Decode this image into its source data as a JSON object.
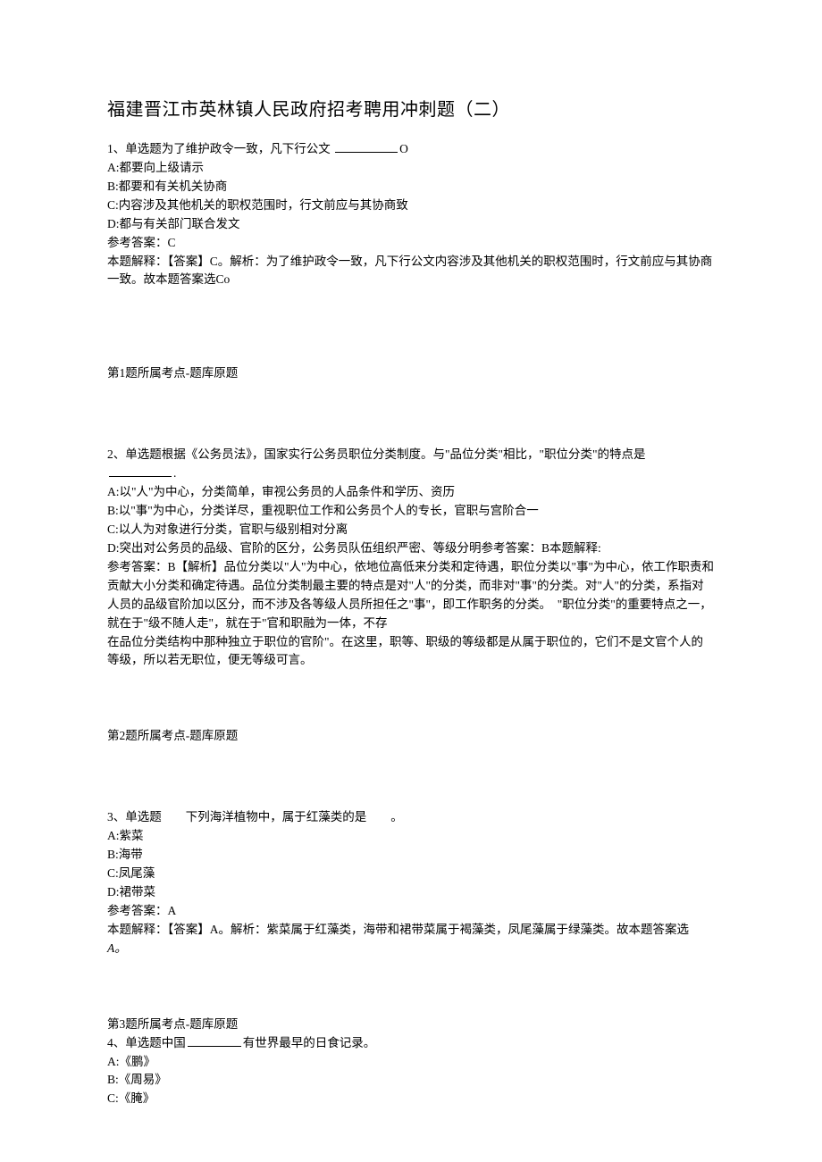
{
  "title": "福建晋江市英林镇人民政府招考聘用冲刺题（二）",
  "q1": {
    "stem_a": "1、单选题为了维护政令一致，凡下行公文 ",
    "stem_b": "O",
    "A": "A:都要向上级请示",
    "B": "B:都要和有关机关协商",
    "C": "C:内容涉及其他机关的职权范围时，行文前应与其协商致",
    "D": "D:都与有关部门联合发文",
    "ans_label": "参考答案：C",
    "expl": "本题解释：【答案】C。解析：为了维护政令一致，凡下行公文内容涉及其他机关的职权范围时，行文前应与其协商一致。故本题答案选Co",
    "meta": "第1题所属考点-题库原题"
  },
  "q2": {
    "stem": "2、单选题根据《公务员法》，国家实行公务员职位分类制度。与\"品位分类\"相比，\"职位分类\"的特点是",
    "A": "A:以\"人\"为中心，分类简单，审视公务员的人品条件和学历、资历",
    "B": "B:以\"事\"为中心，分类详尽，重视职位工作和公务员个人的专长，官职与宫阶合一",
    "C": "C:以人为对象进行分类，官职与级别相对分离",
    "D": "D:突出对公务员的品级、官阶的区分，公务员队伍组织严密、等级分明参考答案：B本题解释:",
    "expl1": "参考答案：B【解析】品位分类以\"人\"为中心，依地位高低来分类和定待遇，职位分类以\"事\"为中心，依工作职责和贡献大小分类和确定待遇。品位分类制最主要的特点是对\"人\"的分类，而非对\"事\"的分类。对\"人\"的分类，系指对人员的品级官阶加以区分，而不涉及各等级人员所担任之\"事\"，即工作职务的分类。　\"职位分类\"的重要特点之一，就在于\"级不随人走\"，就在于\"官和职融为一体，不存",
    "expl2": "在品位分类结构中那种独立于职位的官阶\"。在这里，职等、职级的等级都是从属于职位的，它们不是文官个人的等级，所以若无职位，便无等级可言。",
    "meta": "第2题所属考点-题库原题"
  },
  "q3": {
    "stem": "3、单选题　　下列海洋植物中，属于红藻类的是　　。",
    "A": "A:紫菜",
    "B": "B:海带",
    "C": "C:凤尾藻",
    "D": "D:裙带菜",
    "ans_label": "参考答案：A",
    "expl": "本题解释：【答案】A。解析：紫菜属于红藻类，海带和裙带菜属于褐藻类，凤尾藻属于绿藻类。故本题答案选",
    "expl_tail": "A。",
    "meta": "第3题所属考点-题库原题"
  },
  "q4": {
    "stem_a": "4、单选题中国",
    "stem_b": "有世界最早的日食记录。",
    "A": "A:《鹏》",
    "B": "B:《周易》",
    "C": "C:《腌》"
  }
}
